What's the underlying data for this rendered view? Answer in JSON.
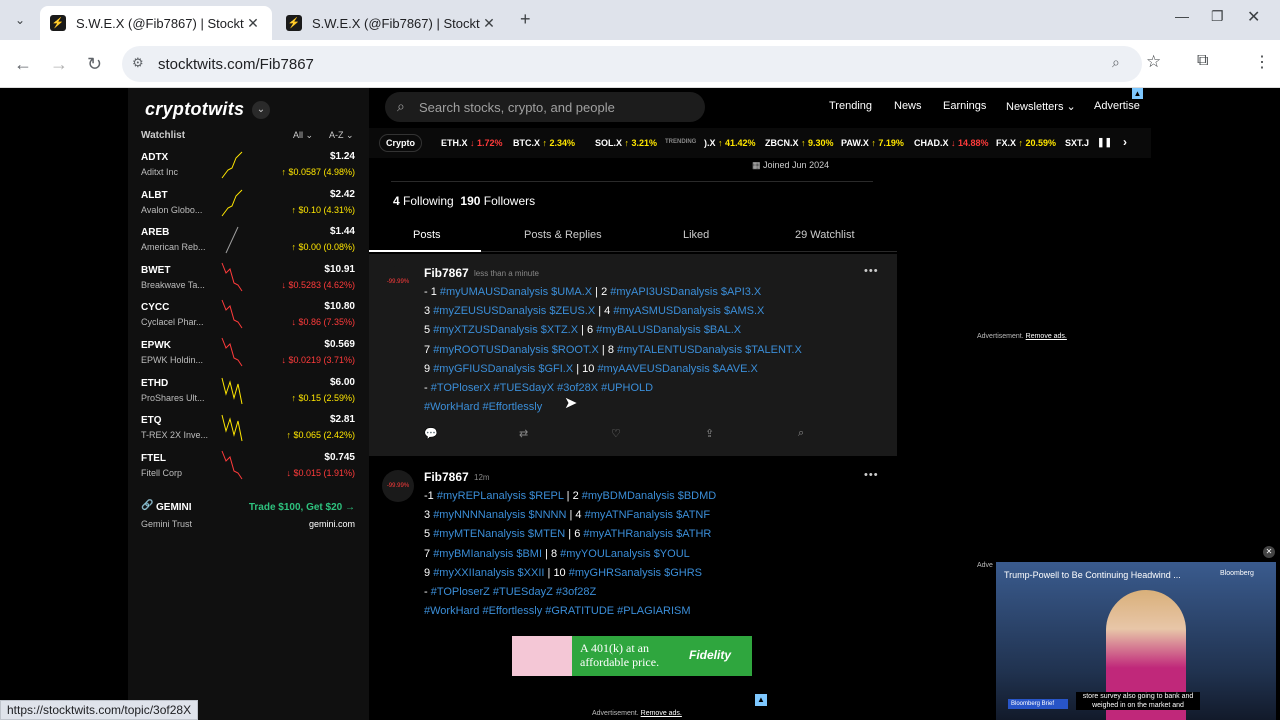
{
  "browser": {
    "tabs": [
      {
        "title": "S.W.E.X (@Fib7867) | Stocktwits",
        "active": true
      },
      {
        "title": "S.W.E.X (@Fib7867) | Stocktwits",
        "active": false
      }
    ],
    "url": "stocktwits.com/Fib7867",
    "status_url": "https://stocktwits.com/topic/3of28X"
  },
  "brand": {
    "logo": "cryptotwits"
  },
  "search": {
    "placeholder": "Search stocks, crypto, and people"
  },
  "topnav": {
    "items": [
      "Trending",
      "News",
      "Earnings",
      "Newsletters",
      "Advertise"
    ]
  },
  "watchlist": {
    "title": "Watchlist",
    "filter": "All",
    "sort": "A-Z",
    "items": [
      {
        "symbol": "ADTX",
        "name": "Aditxt Inc",
        "price": "$1.24",
        "change": "↑ $0.0587 (4.98%)",
        "dir": "up"
      },
      {
        "symbol": "ALBT",
        "name": "Avalon Globo...",
        "price": "$2.42",
        "change": "↑ $0.10 (4.31%)",
        "dir": "up"
      },
      {
        "symbol": "AREB",
        "name": "American Reb...",
        "price": "$1.44",
        "change": "↑ $0.00 (0.08%)",
        "dir": "up"
      },
      {
        "symbol": "BWET",
        "name": "Breakwave Ta...",
        "price": "$10.91",
        "change": "↓ $0.5283 (4.62%)",
        "dir": "down"
      },
      {
        "symbol": "CYCC",
        "name": "Cyclacel Phar...",
        "price": "$10.80",
        "change": "↓ $0.86 (7.35%)",
        "dir": "down"
      },
      {
        "symbol": "EPWK",
        "name": "EPWK Holdin...",
        "price": "$0.569",
        "change": "↓ $0.0219 (3.71%)",
        "dir": "down"
      },
      {
        "symbol": "ETHD",
        "name": "ProShares Ult...",
        "price": "$6.00",
        "change": "↑ $0.15 (2.59%)",
        "dir": "up"
      },
      {
        "symbol": "ETQ",
        "name": "T-REX 2X Inve...",
        "price": "$2.81",
        "change": "↑ $0.065 (2.42%)",
        "dir": "up"
      },
      {
        "symbol": "FTEL",
        "name": "Fitell Corp",
        "price": "$0.745",
        "change": "↓ $0.015 (1.91%)",
        "dir": "down"
      }
    ],
    "promo": {
      "symbol": "GEMINI",
      "name": "Gemini Trust",
      "cta": "Trade $100, Get $20 →",
      "domain": "gemini.com"
    }
  },
  "ticker": {
    "label": "Crypto",
    "trending_label": "TRENDING",
    "items": [
      {
        "sym": "ETH.X",
        "chg": "↓ 1.72%",
        "dir": "down"
      },
      {
        "sym": "BTC.X",
        "chg": "↑ 2.34%",
        "dir": "up"
      },
      {
        "sym": "SOL.X",
        "chg": "↑ 3.21%",
        "dir": "up"
      }
    ],
    "trending": [
      {
        "sym": ").X",
        "chg": "↑ 41.42%",
        "dir": "up"
      },
      {
        "sym": "ZBCN.X",
        "chg": "↑ 9.30%",
        "dir": "up"
      },
      {
        "sym": "PAW.X",
        "chg": "↑ 7.19%",
        "dir": "up"
      },
      {
        "sym": "CHAD.X",
        "chg": "↓ 14.88%",
        "dir": "down"
      },
      {
        "sym": "FX.X",
        "chg": "↑ 20.59%",
        "dir": "up"
      },
      {
        "sym": "SXT.J",
        "chg": "",
        "dir": "up"
      }
    ]
  },
  "profile": {
    "joined": "Joined Jun 2024",
    "following_count": "4",
    "following_label": "Following",
    "followers_count": "190",
    "followers_label": "Followers",
    "tabs": [
      "Posts",
      "Posts & Replies",
      "Liked",
      "29 Watchlist"
    ]
  },
  "posts": [
    {
      "user": "Fib7867",
      "time": "less than a minute",
      "avatar_text": "-99.99%",
      "lines": [
        [
          {
            "t": "- 1 "
          },
          {
            "t": "#myUMAUSDanalysis $UMA.X",
            "tag": true
          },
          {
            "t": " | 2 "
          },
          {
            "t": "#myAPI3USDanalysis $API3.X",
            "tag": true
          }
        ],
        [
          {
            "t": "3 "
          },
          {
            "t": "#myZEUSUSDanalysis $ZEUS.X",
            "tag": true
          },
          {
            "t": " | 4 "
          },
          {
            "t": "#myASMUSDanalysis $AMS.X",
            "tag": true
          }
        ],
        [
          {
            "t": "5 "
          },
          {
            "t": "#myXTZUSDanalysis $XTZ.X",
            "tag": true
          },
          {
            "t": " | 6 "
          },
          {
            "t": "#myBALUSDanalysis $BAL.X",
            "tag": true
          }
        ],
        [
          {
            "t": "7 "
          },
          {
            "t": "#myROOTUSDanalysis $ROOT.X",
            "tag": true
          },
          {
            "t": " | 8 "
          },
          {
            "t": "#myTALENTUSDanalysis $TALENT.X",
            "tag": true
          }
        ],
        [
          {
            "t": "9 "
          },
          {
            "t": "#myGFIUSDanalysis $GFI.X",
            "tag": true
          },
          {
            "t": " | 10 "
          },
          {
            "t": "#myAAVEUSDanalysis $AAVE.X",
            "tag": true
          }
        ],
        [
          {
            "t": "- "
          },
          {
            "t": "#TOPloserX #TUESdayX #3of28X #UPHOLD",
            "tag": true
          }
        ],
        [
          {
            "t": "#WorkHard #Effortlessly",
            "tag": true
          }
        ]
      ]
    },
    {
      "user": "Fib7867",
      "time": "12m",
      "avatar_text": "-99.99%",
      "lines": [
        [
          {
            "t": "-1 "
          },
          {
            "t": "#myREPLanalysis $REPL",
            "tag": true
          },
          {
            "t": " | 2 "
          },
          {
            "t": "#myBDMDanalysis $BDMD",
            "tag": true
          }
        ],
        [
          {
            "t": "3 "
          },
          {
            "t": "#myNNNNanalysis $NNNN",
            "tag": true
          },
          {
            "t": " | 4 "
          },
          {
            "t": "#myATNFanalysis $ATNF",
            "tag": true
          }
        ],
        [
          {
            "t": "5 "
          },
          {
            "t": "#myMTENanalysis $MTEN",
            "tag": true
          },
          {
            "t": " | 6 "
          },
          {
            "t": "#myATHRanalysis $ATHR",
            "tag": true
          }
        ],
        [
          {
            "t": "7 "
          },
          {
            "t": "#myBMIanalysis $BMI",
            "tag": true
          },
          {
            "t": " | 8 "
          },
          {
            "t": "#myYOULanalysis $YOUL",
            "tag": true
          }
        ],
        [
          {
            "t": "9 "
          },
          {
            "t": "#myXXIIanalysis $XXII",
            "tag": true
          },
          {
            "t": " | 10 "
          },
          {
            "t": "#myGHRSanalysis $GHRS",
            "tag": true
          }
        ],
        [
          {
            "t": "- "
          },
          {
            "t": "#TOPloserZ #TUESdayZ #3of28Z",
            "tag": true
          }
        ],
        [
          {
            "t": "#WorkHard #Effortlessly #GRATITUDE #PLAGIARISM",
            "tag": true
          }
        ]
      ]
    }
  ],
  "ads": {
    "side_label": "Advertisement.",
    "side_remove": "Remove ads.",
    "side_label_short": "Adve",
    "bottom_label": "Advertisement.",
    "bottom_remove": "Remove ads.",
    "banner_text": "A 401(k) at an affordable price.",
    "banner_brand": "Fidelity"
  },
  "video": {
    "headline": "Trump-Powell to Be Continuing Headwind ...",
    "source": "Bloomberg",
    "caption": "store survey also going to bank and weighed in on the market and",
    "lower_label": "Bloomberg Brief"
  },
  "colors": {
    "up": "#ffe600",
    "down": "#ff3b3b",
    "link": "#3b8ed8"
  }
}
